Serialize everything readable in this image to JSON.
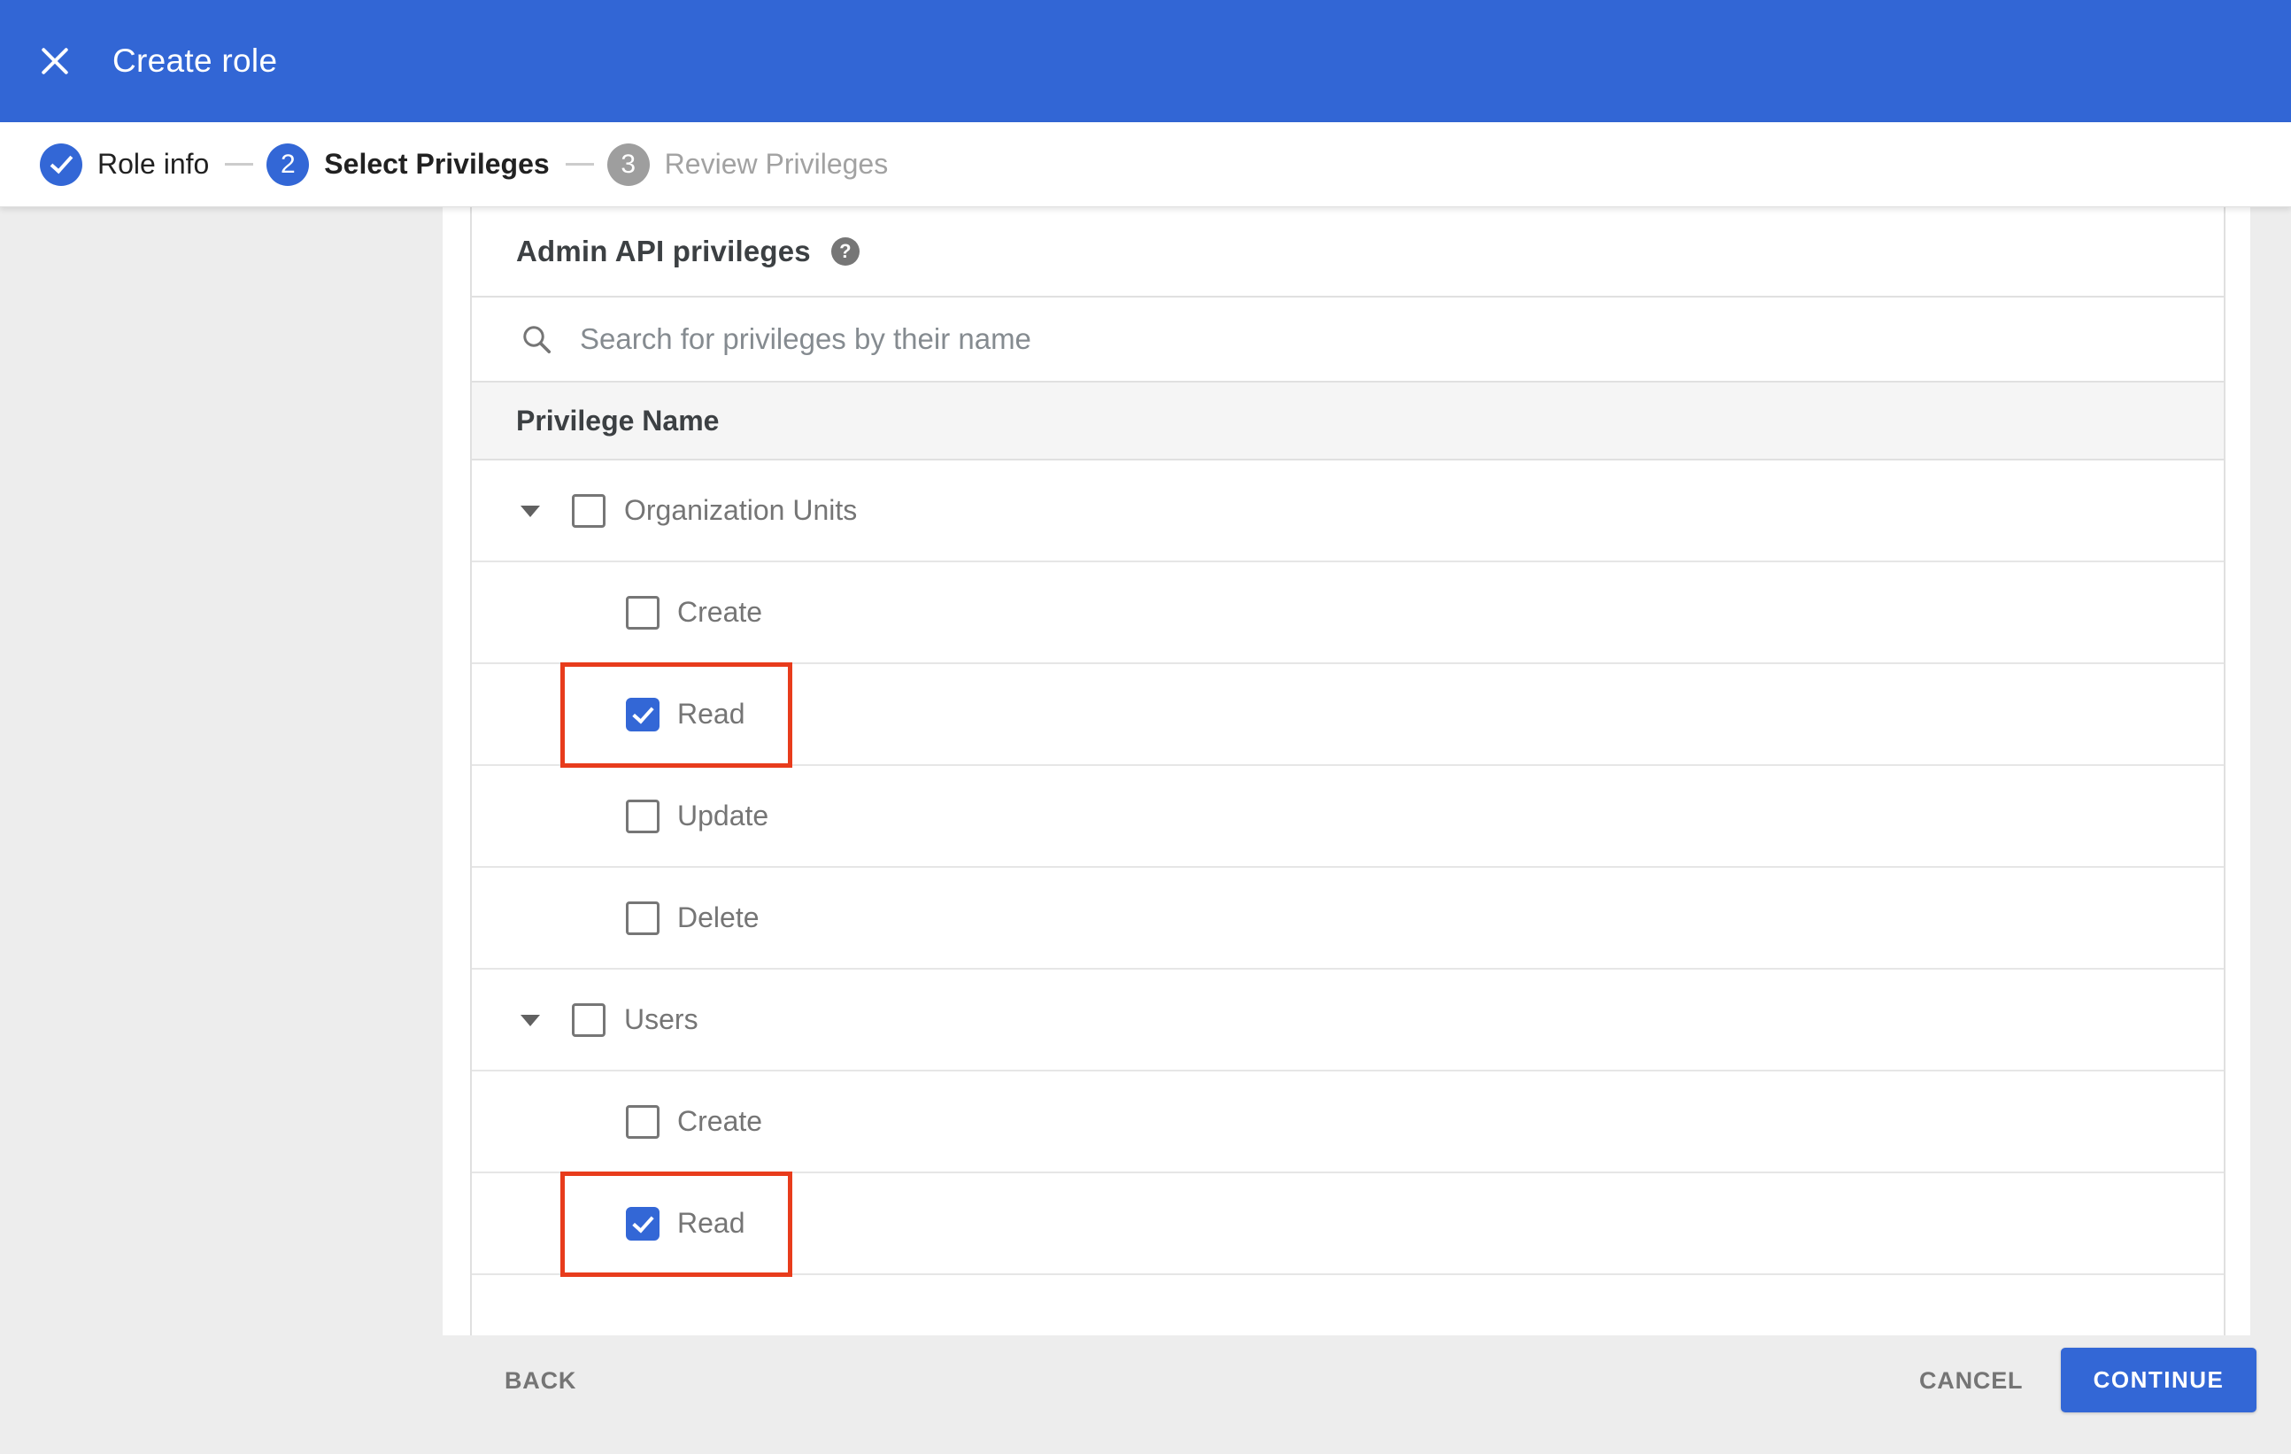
{
  "titlebar": {
    "title": "Create role"
  },
  "stepper": {
    "steps": [
      {
        "label": "Role info",
        "state": "done"
      },
      {
        "label": "Select Privileges",
        "number": "2",
        "state": "active"
      },
      {
        "label": "Review Privileges",
        "number": "3",
        "state": "upcoming"
      }
    ]
  },
  "privileges_panel": {
    "heading": "Admin API privileges",
    "help_glyph": "?",
    "search_placeholder": "Search for privileges by their name",
    "search_value": "",
    "column_header": "Privilege Name",
    "rows": [
      {
        "type": "group",
        "label": "Organization Units",
        "checked": false,
        "highlighted": false
      },
      {
        "type": "child",
        "label": "Create",
        "checked": false,
        "highlighted": false
      },
      {
        "type": "child",
        "label": "Read",
        "checked": true,
        "highlighted": true
      },
      {
        "type": "child",
        "label": "Update",
        "checked": false,
        "highlighted": false
      },
      {
        "type": "child",
        "label": "Delete",
        "checked": false,
        "highlighted": false
      },
      {
        "type": "group",
        "label": "Users",
        "checked": false,
        "highlighted": false
      },
      {
        "type": "child",
        "label": "Create",
        "checked": false,
        "highlighted": false
      },
      {
        "type": "child",
        "label": "Read",
        "checked": true,
        "highlighted": true
      }
    ]
  },
  "footer": {
    "back_label": "BACK",
    "cancel_label": "CANCEL",
    "continue_label": "CONTINUE"
  },
  "colors": {
    "topbar_blue": "#3266d5",
    "accent_blue": "#3367d6",
    "step_inactive": "#9e9e9e",
    "highlight_red": "#e83c1c",
    "page_bg": "#ededed",
    "header_row_bg": "#f5f5f5",
    "row_border": "#e0e0e0",
    "text_dark": "#3c4043",
    "text_gray": "#757575"
  }
}
